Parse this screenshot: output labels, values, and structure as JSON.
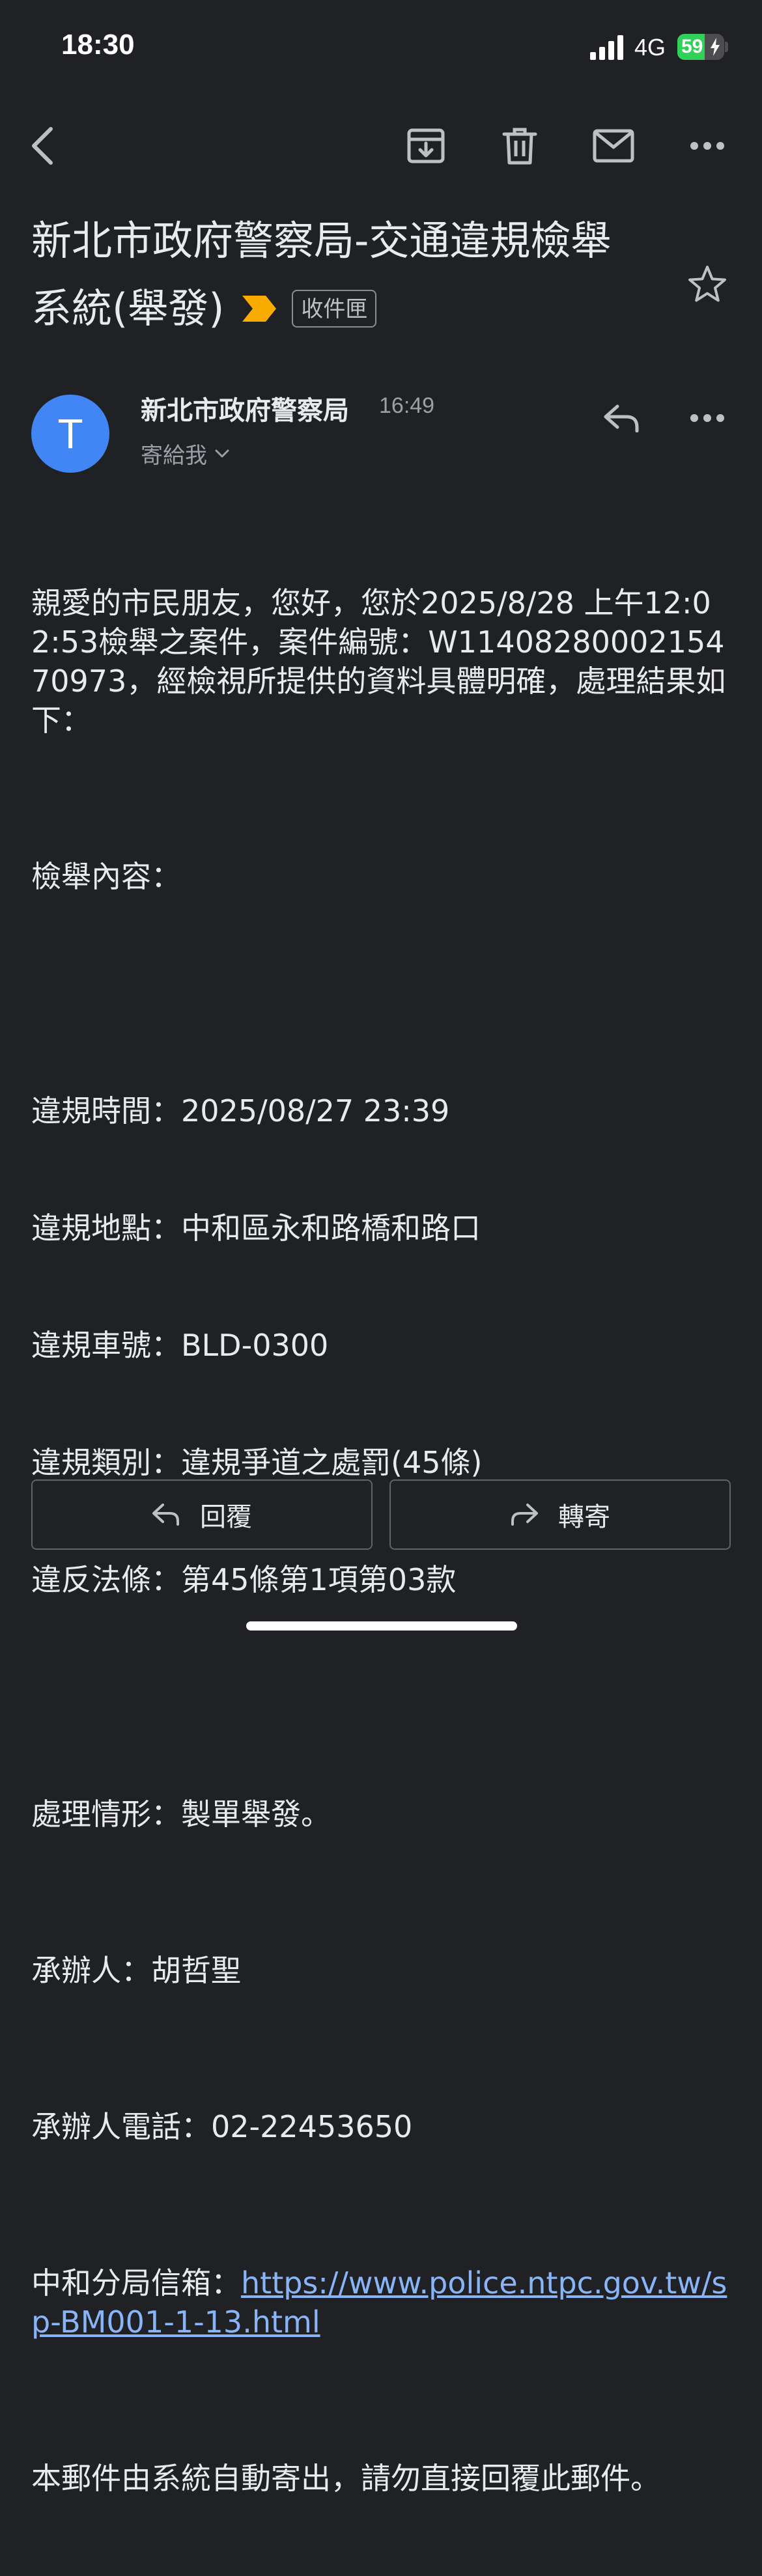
{
  "status_bar": {
    "time": "18:30",
    "network": "4G",
    "battery_percent": "59",
    "battery_level": 0.59,
    "battery_color": "#30d158"
  },
  "toolbar": {
    "icons": [
      "back-arrow-icon",
      "archive-icon",
      "trash-icon",
      "mail-unread-icon",
      "more-horizontal-icon"
    ]
  },
  "email": {
    "subject": "新北市政府警察局-交通違規檢舉系統(舉發)",
    "label_badge": "收件匣",
    "importance_color": "#f9ab00",
    "sender": {
      "initial": "T",
      "name": "新北市政府警察局",
      "time": "16:49",
      "recipient_summary": "寄給我",
      "avatar_color": "#4285f4"
    },
    "body": {
      "intro": "親愛的市民朋友，您好，您於2025/8/28 上午12:02:53檢舉之案件，案件編號：W1140828000215470973，經檢視所提供的資料具體明確，處理結果如下：",
      "section_title": "檢舉內容：",
      "details": [
        "違規時間：2025/08/27 23:39",
        "違規地點：中和區永和路橋和路口",
        "違規車號：BLD-0300",
        "違規類別：違規爭道之處罰(45條)",
        "違反法條：第45條第1項第03款"
      ],
      "handling": "處理情形：製單舉發。",
      "officer": "承辦人：胡哲聖",
      "officer_phone": "承辦人電話：02-22453650",
      "mailbox_label": "中和分局信箱：",
      "mailbox_link": "https://www.police.ntpc.gov.tw/sp-BM001-1-13.html",
      "footer": "本郵件由系統自動寄出，請勿直接回覆此郵件。"
    }
  },
  "actions": {
    "reply_label": "回覆",
    "forward_label": "轉寄"
  }
}
